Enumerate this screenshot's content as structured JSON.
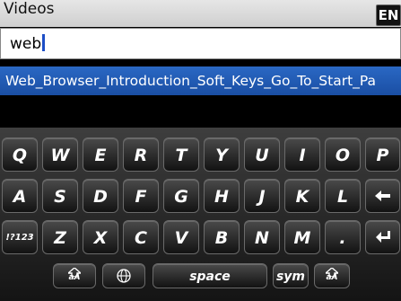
{
  "header": {
    "title": "Videos",
    "lang_indicator": "EN"
  },
  "search": {
    "value": "web"
  },
  "results": [
    {
      "label": "Web_Browser_Introduction_Soft_Keys_Go_To_Start_Pa"
    }
  ],
  "keyboard": {
    "row1": [
      "Q",
      "W",
      "E",
      "R",
      "T",
      "Y",
      "U",
      "I",
      "O",
      "P"
    ],
    "row2": [
      "A",
      "S",
      "D",
      "F",
      "G",
      "H",
      "J",
      "K",
      "L"
    ],
    "row3": [
      "Z",
      "X",
      "C",
      "V",
      "B",
      "N",
      "M",
      "."
    ],
    "mode_key": "!?123",
    "space_label": "space",
    "sym_label": "sym",
    "shift_label": "aA"
  },
  "icons": {
    "backspace": "backspace-arrow-icon",
    "enter": "enter-return-icon",
    "shift": "shift-arrow-icon",
    "globe": "globe-icon"
  }
}
